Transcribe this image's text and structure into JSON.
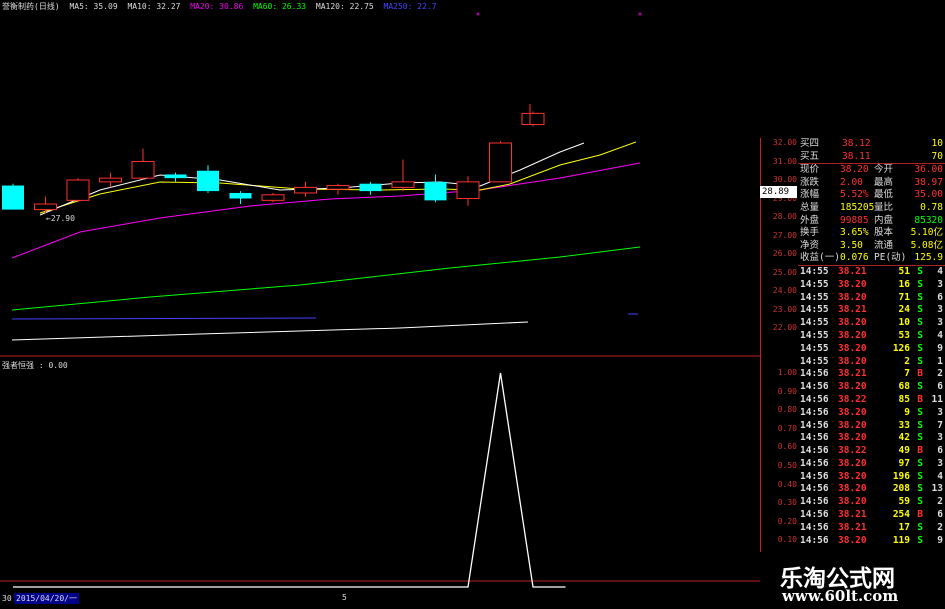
{
  "title_bar": {
    "stock_name": "誉衡制药(日线)",
    "ma5": "MA5: 35.09",
    "ma10": "MA10: 32.27",
    "ma20": "MA20: 30.86",
    "ma60": "MA60: 26.33",
    "ma120": "MA120: 22.75",
    "ma250": "MA250: 22.7"
  },
  "colors": {
    "up": "#ff3030",
    "down": "#00ffff",
    "ma5": "#ffffff",
    "ma10": "#ffff00",
    "ma20": "#ff00ff",
    "ma60": "#00ff00",
    "ma120": "#ffffff",
    "ma250": "#4040ff"
  },
  "chart_data": {
    "type": "candlestick",
    "price_axis_ticks": [
      "32.00",
      "31.00",
      "30.00",
      "29.00",
      "28.00",
      "27.00",
      "26.00",
      "25.00",
      "24.00",
      "23.00",
      "22.00"
    ],
    "current_price_tag": "28.89",
    "low_annotation": "←27.90",
    "candles": [
      {
        "o": 29.7,
        "c": 28.4,
        "h": 29.8,
        "l": 28.4
      },
      {
        "o": 28.4,
        "c": 28.7,
        "h": 29.1,
        "l": 28.2
      },
      {
        "o": 28.9,
        "c": 30.0,
        "h": 30.1,
        "l": 28.8
      },
      {
        "o": 29.9,
        "c": 30.1,
        "h": 30.4,
        "l": 29.6
      },
      {
        "o": 30.1,
        "c": 31.0,
        "h": 31.7,
        "l": 30.0
      },
      {
        "o": 30.3,
        "c": 30.1,
        "h": 30.4,
        "l": 29.9
      },
      {
        "o": 30.5,
        "c": 29.4,
        "h": 30.8,
        "l": 29.3
      },
      {
        "o": 29.3,
        "c": 29.0,
        "h": 29.4,
        "l": 28.7
      },
      {
        "o": 28.9,
        "c": 29.2,
        "h": 29.3,
        "l": 28.8
      },
      {
        "o": 29.3,
        "c": 29.6,
        "h": 29.9,
        "l": 29.1
      },
      {
        "o": 29.5,
        "c": 29.7,
        "h": 29.8,
        "l": 29.2
      },
      {
        "o": 29.8,
        "c": 29.4,
        "h": 29.9,
        "l": 29.2
      },
      {
        "o": 29.6,
        "c": 29.9,
        "h": 31.1,
        "l": 29.4
      },
      {
        "o": 29.9,
        "c": 28.9,
        "h": 30.3,
        "l": 28.8
      },
      {
        "o": 29.0,
        "c": 29.9,
        "h": 30.2,
        "l": 28.6
      },
      {
        "o": 29.9,
        "c": 32.0,
        "h": 32.1,
        "l": 29.9
      },
      {
        "o": 33.0,
        "c": 33.6,
        "h": 33.7,
        "l": 32.9
      }
    ],
    "indicator": {
      "title": "强者恒强 : 0.00",
      "ticks": [
        "1.00",
        "0.90",
        "0.80",
        "0.70",
        "0.60",
        "0.50",
        "0.40",
        "0.30",
        "0.20",
        "0.10"
      ],
      "values": [
        0,
        0,
        0,
        0,
        0,
        0,
        0,
        0,
        0,
        0,
        0,
        0,
        0,
        0,
        0,
        1,
        0,
        0
      ]
    }
  },
  "quote_panel": {
    "buy4_label": "买四",
    "buy4_price": "38.12",
    "buy4_vol": "10",
    "buy5_label": "买五",
    "buy5_price": "38.11",
    "buy5_vol": "70",
    "rows": [
      {
        "l1": "现价",
        "v1": "38.20",
        "l2": "今开",
        "v2": "36.00"
      },
      {
        "l1": "涨跌",
        "v1": "2.00",
        "l2": "最高",
        "v2": "38.97"
      },
      {
        "l1": "涨幅",
        "v1": "5.52%",
        "l2": "最低",
        "v2": "35.00"
      },
      {
        "l1": "总量",
        "v1": "185205",
        "l2": "量比",
        "v2": "0.78"
      },
      {
        "l1": "外盘",
        "v1": "99885",
        "l2": "内盘",
        "v2": "85320"
      },
      {
        "l1": "换手",
        "v1": "3.65%",
        "l2": "股本",
        "v2": "5.10亿"
      },
      {
        "l1": "净资",
        "v1": "3.50",
        "l2": "流通",
        "v2": "5.08亿"
      },
      {
        "l1": "收益(一)",
        "v1": "0.076",
        "l2": "PE(动)",
        "v2": "125.9"
      }
    ]
  },
  "trades": [
    {
      "t": "14:55",
      "p": "38.21",
      "v": "51",
      "d": "S",
      "n": "4"
    },
    {
      "t": "14:55",
      "p": "38.20",
      "v": "16",
      "d": "S",
      "n": "3"
    },
    {
      "t": "14:55",
      "p": "38.20",
      "v": "71",
      "d": "S",
      "n": "6"
    },
    {
      "t": "14:55",
      "p": "38.21",
      "v": "24",
      "d": "S",
      "n": "3"
    },
    {
      "t": "14:55",
      "p": "38.20",
      "v": "10",
      "d": "S",
      "n": "3"
    },
    {
      "t": "14:55",
      "p": "38.20",
      "v": "53",
      "d": "S",
      "n": "4"
    },
    {
      "t": "14:55",
      "p": "38.20",
      "v": "126",
      "d": "S",
      "n": "9"
    },
    {
      "t": "14:55",
      "p": "38.20",
      "v": "2",
      "d": "S",
      "n": "1"
    },
    {
      "t": "14:56",
      "p": "38.21",
      "v": "7",
      "d": "B",
      "n": "2"
    },
    {
      "t": "14:56",
      "p": "38.20",
      "v": "68",
      "d": "S",
      "n": "6"
    },
    {
      "t": "14:56",
      "p": "38.22",
      "v": "85",
      "d": "B",
      "n": "11"
    },
    {
      "t": "14:56",
      "p": "38.20",
      "v": "9",
      "d": "S",
      "n": "3"
    },
    {
      "t": "14:56",
      "p": "38.20",
      "v": "33",
      "d": "S",
      "n": "7"
    },
    {
      "t": "14:56",
      "p": "38.20",
      "v": "42",
      "d": "S",
      "n": "3"
    },
    {
      "t": "14:56",
      "p": "38.22",
      "v": "49",
      "d": "B",
      "n": "6"
    },
    {
      "t": "14:56",
      "p": "38.20",
      "v": "97",
      "d": "S",
      "n": "3"
    },
    {
      "t": "14:56",
      "p": "38.20",
      "v": "196",
      "d": "S",
      "n": "4"
    },
    {
      "t": "14:56",
      "p": "38.20",
      "v": "208",
      "d": "S",
      "n": "13"
    },
    {
      "t": "14:56",
      "p": "38.20",
      "v": "59",
      "d": "S",
      "n": "2"
    },
    {
      "t": "14:56",
      "p": "38.21",
      "v": "254",
      "d": "B",
      "n": "6"
    },
    {
      "t": "14:56",
      "p": "38.21",
      "v": "17",
      "d": "S",
      "n": "2"
    },
    {
      "t": "14:56",
      "p": "38.20",
      "v": "119",
      "d": "S",
      "n": "9"
    }
  ],
  "footer": {
    "tab1": "30",
    "date": "2015/04/20/一",
    "marker": "5"
  },
  "watermark": {
    "title": "乐淘公式网",
    "url": "www.60lt.com"
  }
}
